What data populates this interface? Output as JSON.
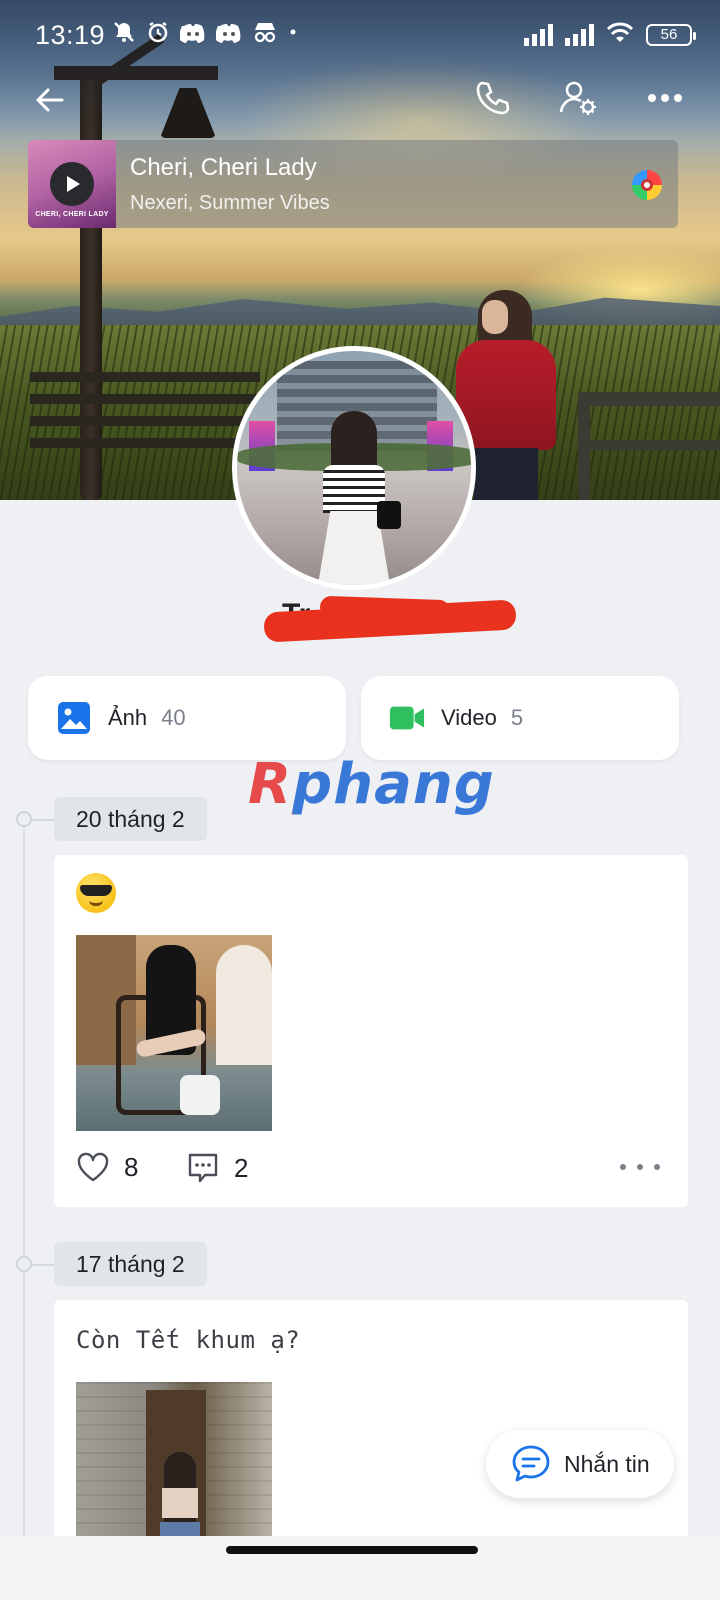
{
  "status_bar": {
    "time": "13:19",
    "battery": "56",
    "left_icons": [
      "bell-off-icon",
      "alarm-icon",
      "discord-icon",
      "discord-icon",
      "incognito-icon",
      "dot-icon"
    ],
    "right_icons": [
      "signal-icon",
      "signal-icon",
      "wifi-icon",
      "battery-icon"
    ]
  },
  "header": {
    "back_icon": "arrow-left-icon",
    "call_icon": "phone-icon",
    "settings_icon": "user-settings-icon",
    "more_icon": "more-horizontal-icon"
  },
  "music": {
    "title": "Cheri, Cheri Lady",
    "artist": "Nexeri, Summer Vibes",
    "art_text": "CHERI, CHERI LADY"
  },
  "profile": {
    "name": "Tr... T...",
    "name_redacted": true
  },
  "media": {
    "photo_label": "Ảnh",
    "photo_count": "40",
    "video_label": "Video",
    "video_count": "5"
  },
  "watermark": "Rphang",
  "timeline": [
    {
      "date": "20 tháng 2",
      "emoji": "😎",
      "likes": "8",
      "comments": "2"
    },
    {
      "date": "17 tháng 2",
      "text": "Còn Tết khum ạ?"
    }
  ],
  "fab": {
    "label": "Nhắn tin"
  },
  "colors": {
    "photo_accent": "#1a73e8",
    "video_accent": "#2fbf5f",
    "background": "#eef0f3",
    "redaction": "#e8321d"
  }
}
